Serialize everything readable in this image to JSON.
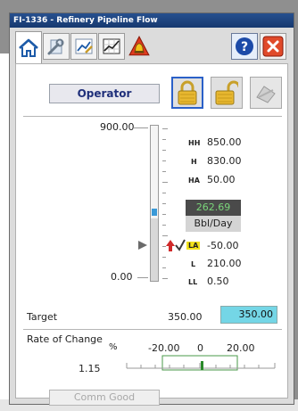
{
  "window": {
    "title": "FI-1336 - Refinery Pipeline Flow"
  },
  "toolbar": {
    "tabs": [
      {
        "icon": "home-icon"
      },
      {
        "icon": "wrench-icon"
      },
      {
        "icon": "trend-edit-icon"
      },
      {
        "icon": "trend-chart-icon"
      },
      {
        "icon": "alarm-icon"
      }
    ],
    "help_icon": "help-icon",
    "close_icon": "close-icon"
  },
  "mode": {
    "label": "Operator"
  },
  "locks": {
    "locked_icon": "lock-closed-icon",
    "unlocked_icon": "lock-open-icon",
    "reset_icon": "reset-icon"
  },
  "scale": {
    "max": "900.00",
    "min": "0.00"
  },
  "alarms": [
    {
      "tag": "HH",
      "value": "850.00"
    },
    {
      "tag": "H",
      "value": "830.00"
    },
    {
      "tag": "HA",
      "value": "50.00"
    },
    {
      "tag": "LA",
      "value": "-50.00"
    },
    {
      "tag": "L",
      "value": "210.00"
    },
    {
      "tag": "LL",
      "value": "0.50"
    }
  ],
  "pv": {
    "value": "262.69",
    "units": "Bbl/Day"
  },
  "target": {
    "label": "Target",
    "readback": "350.00",
    "input_value": "350.00"
  },
  "rate_of_change": {
    "label": "Rate of Change",
    "unit": "%",
    "value": "1.15",
    "scale_labels": [
      "-20.00",
      "0",
      "20.00"
    ]
  },
  "status": {
    "comm": "Comm Good"
  },
  "colors": {
    "titlebar": "#1f4a8a",
    "pv_text": "#7ad67a",
    "target_input": "#74d6e6",
    "lock_border": "#2a60c8"
  }
}
